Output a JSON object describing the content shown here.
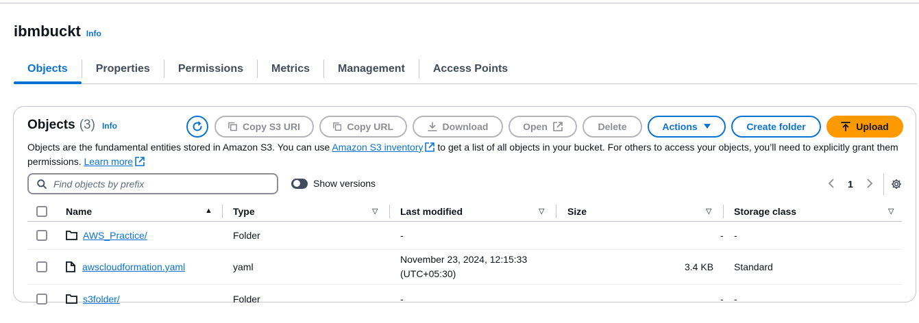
{
  "header": {
    "title": "ibmbuckt",
    "info": "Info"
  },
  "tabs": [
    {
      "label": "Objects",
      "active": true
    },
    {
      "label": "Properties"
    },
    {
      "label": "Permissions"
    },
    {
      "label": "Metrics"
    },
    {
      "label": "Management"
    },
    {
      "label": "Access Points"
    }
  ],
  "objects_panel": {
    "title": "Objects",
    "count": "(3)",
    "info": "Info",
    "buttons": {
      "copy_s3_uri": "Copy S3 URI",
      "copy_url": "Copy URL",
      "download": "Download",
      "open": "Open",
      "delete": "Delete",
      "actions": "Actions",
      "create_folder": "Create folder",
      "upload": "Upload"
    },
    "description": {
      "part1": "Objects are the fundamental entities stored in Amazon S3. You can use ",
      "inventory_link": "Amazon S3 inventory",
      "part2": " to get a list of all objects in your bucket. For others to access your objects, you’ll need to explicitly grant them permissions. ",
      "learn_more": "Learn more"
    },
    "search": {
      "placeholder": "Find objects by prefix",
      "value": ""
    },
    "show_versions_label": "Show versions",
    "pagination": {
      "current_page": "1"
    }
  },
  "table": {
    "columns": [
      "Name",
      "Type",
      "Last modified",
      "Size",
      "Storage class"
    ],
    "rows": [
      {
        "icon": "folder-icon",
        "name": "AWS_Practice/",
        "type": "Folder",
        "last_modified": "-",
        "last_modified_line2": "",
        "size": "-",
        "storage_class": "-"
      },
      {
        "icon": "file-icon",
        "name": "awscloudformation.yaml",
        "type": "yaml",
        "last_modified": "November 23, 2024, 12:15:33",
        "last_modified_line2": "(UTC+05:30)",
        "size": "3.4 KB",
        "storage_class": "Standard"
      },
      {
        "icon": "folder-icon",
        "name": "s3folder/",
        "type": "Folder",
        "last_modified": "-",
        "last_modified_line2": "",
        "size": "-",
        "storage_class": "-"
      }
    ]
  },
  "colors": {
    "link_blue": "#0972d3",
    "upload_orange": "#ff9900",
    "disabled_gray": "#8c8c94"
  }
}
